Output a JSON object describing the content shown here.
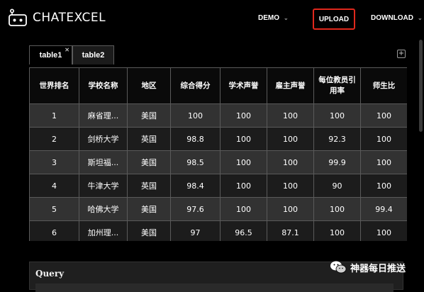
{
  "app": {
    "title": "ChatExcel"
  },
  "nav": {
    "demo": "DEMO",
    "upload": "UPLOAD",
    "download": "DOWNLOAD"
  },
  "tabs": [
    {
      "label": "table1",
      "active": true
    },
    {
      "label": "table2",
      "active": false
    }
  ],
  "table": {
    "columns": [
      "世界排名",
      "学校名称",
      "地区",
      "综合得分",
      "学术声誉",
      "雇主声誉",
      "每位教员引用率",
      "师生比"
    ],
    "rows": [
      [
        "1",
        "麻省理...",
        "美国",
        "100",
        "100",
        "100",
        "100",
        "100"
      ],
      [
        "2",
        "剑桥大学",
        "英国",
        "98.8",
        "100",
        "100",
        "92.3",
        "100"
      ],
      [
        "3",
        "斯坦福...",
        "美国",
        "98.5",
        "100",
        "100",
        "99.9",
        "100"
      ],
      [
        "4",
        "牛津大学",
        "英国",
        "98.4",
        "100",
        "100",
        "90",
        "100"
      ],
      [
        "5",
        "哈佛大学",
        "美国",
        "97.6",
        "100",
        "100",
        "100",
        "99.4"
      ],
      [
        "6",
        "加州理...",
        "美国",
        "97",
        "96.5",
        "87.1",
        "100",
        "100"
      ]
    ]
  },
  "query": {
    "label": "Query"
  },
  "watermark": {
    "text": "神器每日推送"
  },
  "colors": {
    "accent_border": "#e0281c",
    "row_light": "#323232",
    "row_dark": "#1c1c1c"
  }
}
